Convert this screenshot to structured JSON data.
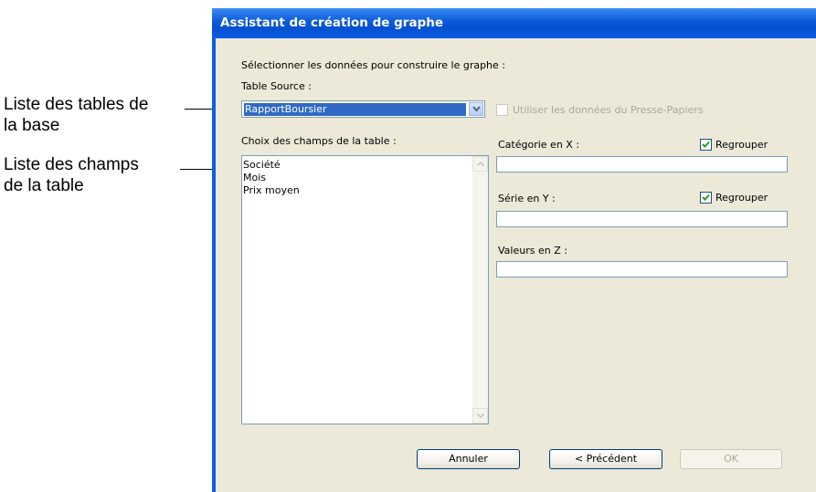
{
  "annotations": {
    "tables_label": [
      "Liste des tables de",
      "la base"
    ],
    "fields_label": [
      "Liste des champs",
      "de la table"
    ]
  },
  "dialog": {
    "title": "Assistant de création de graphe",
    "instruction": "Sélectionner les données pour construire le graphe :",
    "table_source_label": "Table Source :",
    "table_source_value": "RapportBoursier",
    "clipboard_label": "Utiliser les données du Presse-Papiers",
    "fields_list_label": "Choix des champs de la table :",
    "fields": [
      "Société",
      "Mois",
      "Prix moyen"
    ],
    "category_x_label": "Catégorie en X :",
    "series_y_label": "Série en Y :",
    "values_z_label": "Valeurs en Z :",
    "group_label": "Regrouper",
    "category_x_value": "",
    "series_y_value": "",
    "values_z_value": "",
    "buttons": {
      "cancel": "Annuler",
      "previous": "< Précédent",
      "ok": "OK"
    }
  },
  "colors": {
    "titlebar": "#0a58d8",
    "dialog_bg": "#ece9d8",
    "selection": "#316ac5"
  }
}
